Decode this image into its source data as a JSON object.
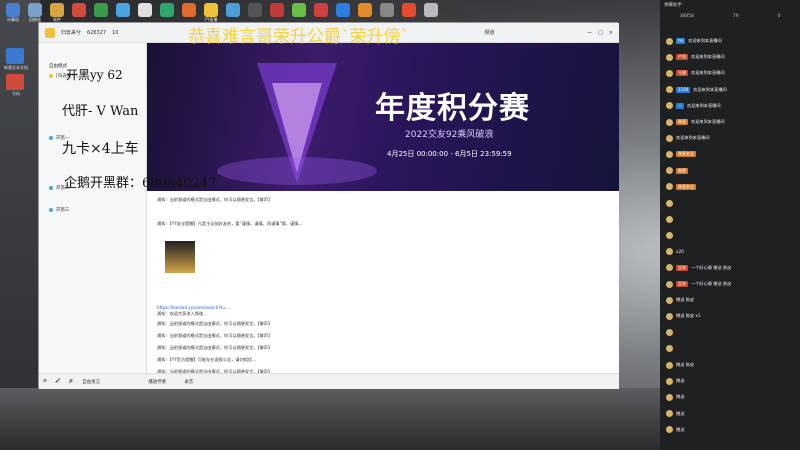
{
  "top_icons": [
    {
      "label": "计算机",
      "color": "#4a7fd0"
    },
    {
      "label": "回收站",
      "color": "#7aa1c8"
    },
    {
      "label": "软件",
      "color": "#d9a441"
    },
    {
      "label": "",
      "color": "#d24b3f"
    },
    {
      "label": "",
      "color": "#3a9b4a"
    },
    {
      "label": "",
      "color": "#4aa3df"
    },
    {
      "label": "",
      "color": "#e0e0e0"
    },
    {
      "label": "",
      "color": "#2fa66b"
    },
    {
      "label": "",
      "color": "#e06b2f"
    },
    {
      "label": "YY直播",
      "color": "#f0c23c"
    },
    {
      "label": "",
      "color": "#4a9fd8"
    },
    {
      "label": "",
      "color": "#555"
    },
    {
      "label": "",
      "color": "#c23a3a"
    },
    {
      "label": "",
      "color": "#6bbd4a"
    },
    {
      "label": "",
      "color": "#d04040"
    },
    {
      "label": "",
      "color": "#2c7de0"
    },
    {
      "label": "",
      "color": "#e58a2c"
    },
    {
      "label": "",
      "color": "#888"
    },
    {
      "label": "",
      "color": "#e54a2c"
    },
    {
      "label": "",
      "color": "#bbb"
    }
  ],
  "desk_icons": [
    {
      "label": "新建文本文档",
      "color": "#3b78d0"
    },
    {
      "label": "号码",
      "color": "#d14b3c"
    }
  ],
  "window": {
    "title": "归去来兮",
    "channel_id": "626327",
    "online": "10",
    "dropdown": "频道"
  },
  "overlay": {
    "headline": "恭喜难言哥荣升公爵`荣升傍`",
    "line1": "开黑yy    62",
    "line2": "代肝- V Wan",
    "line3": "九卡×4上车",
    "line4": "企鹅开黑群：689840247"
  },
  "banner": {
    "title": "年度积分赛",
    "subtitle": "2022交友92乘风破浪",
    "dates": "4月25日 00:00:00 - 6月5日 23:59:59"
  },
  "sidebar": {
    "mode": "自由模式",
    "items": [
      "[归去来兮]",
      "开黑一",
      "开黑二",
      "开黑三"
    ]
  },
  "chat": {
    "lines": [
      "通知：当前频道的模式是自由模式，你可以随便发言。【掌声】",
      "通知：【YY安全提醒】凡是主动加好友的，要“谨慎，谨慎，再谨慎”哦，谨慎...",
      "通知：欢迎大家进入频道...",
      "https://lianliao.yy.com/search?k=...",
      "通知：当前频道的模式是自由模式，你可以随便发言。【掌声】",
      "通知：当前频道的模式是自由模式，你可以随便发言。【掌声】",
      "通知：当前频道的模式是自由模式，你可以随便发言。【掌声】",
      "通知：【YY官方提醒】可能存在虚假公告，请勿相信...",
      "通知：当前频道的模式是自由模式，你可以随便发言。【掌声】"
    ]
  },
  "bottom_bar": {
    "mode": "自由发言",
    "play": "播放伴奏",
    "record": "录音"
  },
  "right_panel": {
    "header": "弹幕助手",
    "stats": [
      "38858",
      "79",
      "0"
    ],
    "messages": [
      {
        "badge": "tal",
        "text": "欢迎来到本直播间",
        "color": "#2a7ad0"
      },
      {
        "badge": "卢哥",
        "text": "欢迎来到本直播间",
        "color": "#c84a2a"
      },
      {
        "badge": "马猫",
        "text": "欢迎来到本直播间",
        "color": "#c84a2a"
      },
      {
        "badge": "1100",
        "text": "欢迎来到本直播间",
        "color": "#2a7ad0"
      },
      {
        "badge": "一",
        "text": "欢迎来到本直播间",
        "color": "#2a7ad0"
      },
      {
        "badge": "林星",
        "text": "欢迎来到本直播间",
        "color": "#d17a2a"
      },
      {
        "badge": "",
        "text": "欢迎来到本直播间",
        "color": "#d17a2a"
      },
      {
        "badge": "林星安全",
        "text": "",
        "color": "#d17a2a"
      },
      {
        "badge": "林星",
        "text": "",
        "color": "#d17a2a"
      },
      {
        "badge": "林星安全",
        "text": "",
        "color": "#d17a2a"
      },
      {
        "badge": "",
        "text": "",
        "color": "#d17a2a"
      },
      {
        "badge": "",
        "text": "",
        "color": "#d17a2a"
      },
      {
        "badge": "",
        "text": "",
        "color": "#d17a2a"
      },
      {
        "badge": "",
        "text": "x20",
        "color": "#c84a2a"
      },
      {
        "badge": "没有",
        "text": "一个好心情 赠送 陈皮",
        "color": "#c84a2a"
      },
      {
        "badge": "没有",
        "text": "一个好心情 赠送 陈皮",
        "color": "#c84a2a"
      },
      {
        "badge": "",
        "text": "赠送 陈皮",
        "color": "#c84a2a"
      },
      {
        "badge": "",
        "text": "赠送 陈皮 x1",
        "color": "#c84a2a"
      },
      {
        "badge": "",
        "text": "",
        "color": "#d17a2a"
      },
      {
        "badge": "",
        "text": "",
        "color": "#d17a2a"
      },
      {
        "badge": "",
        "text": "赠送 陈皮",
        "color": "#c84a2a"
      },
      {
        "badge": "",
        "text": "赠送",
        "color": "#c84a2a"
      },
      {
        "badge": "",
        "text": "赠送",
        "color": "#c84a2a"
      },
      {
        "badge": "",
        "text": "赠送",
        "color": "#c84a2a"
      },
      {
        "badge": "",
        "text": "赠送",
        "color": "#c84a2a"
      }
    ]
  }
}
